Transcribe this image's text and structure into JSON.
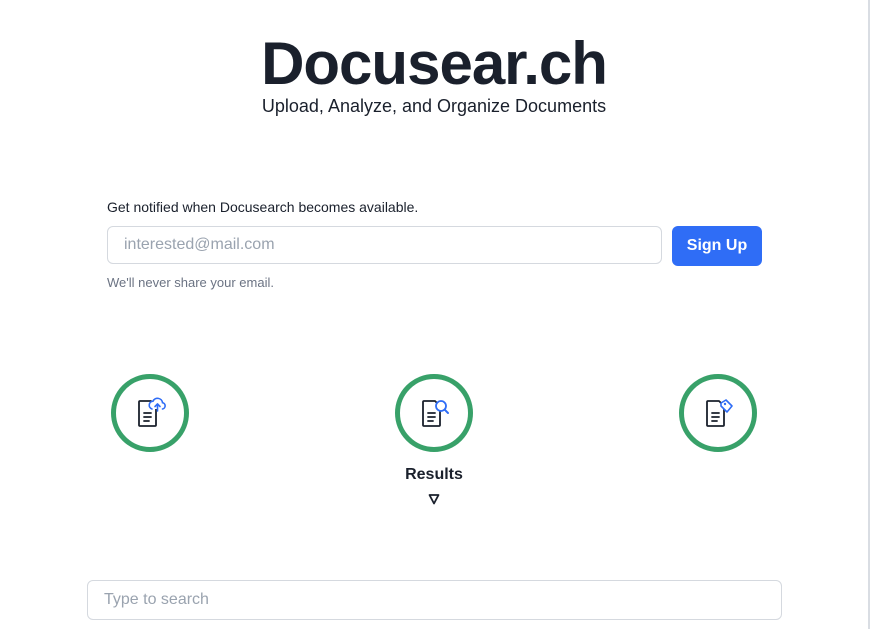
{
  "header": {
    "title": "Docusear.ch",
    "subtitle": "Upload, Analyze, and Organize Documents"
  },
  "signup": {
    "label": "Get notified when Docusearch becomes available.",
    "email_placeholder": "interested@mail.com",
    "button_label": "Sign Up",
    "help_text": "We'll never share your email."
  },
  "features": [
    {
      "icon": "document-upload-icon"
    },
    {
      "icon": "document-search-icon",
      "label": "Results"
    },
    {
      "icon": "document-tag-icon"
    }
  ],
  "search": {
    "placeholder": "Type to search"
  },
  "colors": {
    "accent": "#2f6df6",
    "ring": "#38a169",
    "text": "#1a202c",
    "muted": "#6b7383"
  }
}
